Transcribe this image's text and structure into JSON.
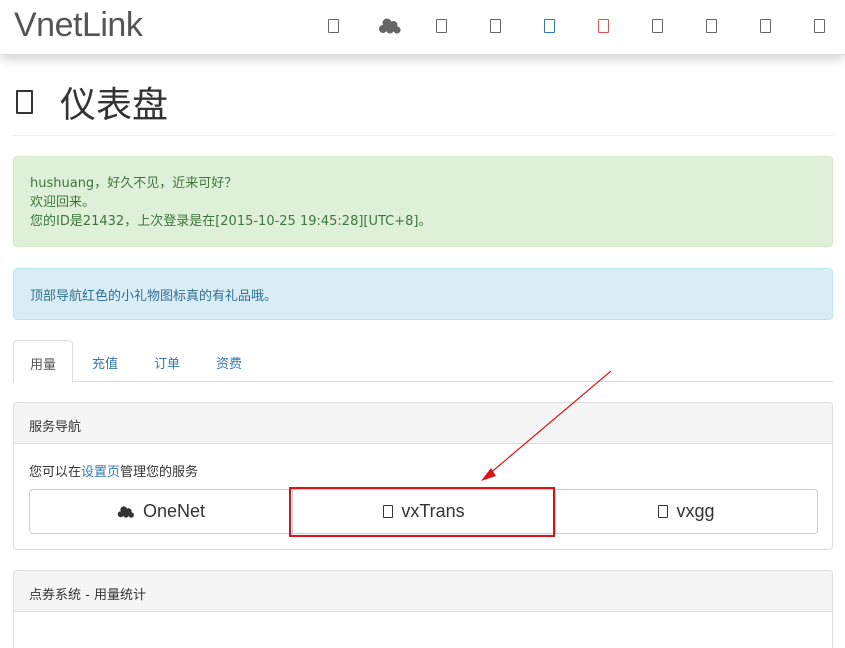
{
  "navbar": {
    "brand": "VnetLink",
    "icons": [
      "box-icon",
      "cloud-icon",
      "box-icon",
      "box-icon",
      "box-icon",
      "gift-icon",
      "box-icon",
      "box-icon",
      "box-icon",
      "box-icon"
    ],
    "icon_colors": {
      "default": "#666666",
      "blue": "#337ab7",
      "red": "#d9534f"
    }
  },
  "header": {
    "title": "仪表盘"
  },
  "alerts": {
    "welcome_line1": "hushuang，好久不见，近来可好？",
    "welcome_line2": "欢迎回来。",
    "welcome_line3": "您的ID是21432，上次登录是在[2015-10-25 19:45:28][UTC+8]。",
    "tip": "顶部导航红色的小礼物图标真的有礼品哦。"
  },
  "tabs": [
    {
      "label": "用量"
    },
    {
      "label": "充值"
    },
    {
      "label": "订单"
    },
    {
      "label": "资费"
    }
  ],
  "service_panel": {
    "heading": "服务导航",
    "manage_prefix": "您可以在",
    "manage_link": "设置页",
    "manage_suffix": "管理您的服务",
    "buttons": [
      {
        "label": "OneNet",
        "icon": "cloud-icon"
      },
      {
        "label": "vxTrans",
        "icon": "box-icon"
      },
      {
        "label": "vxgg",
        "icon": "box-icon"
      }
    ]
  },
  "stats_panel": {
    "heading": "点券系统 - 用量统计"
  },
  "annotation_color": "#d9141b"
}
